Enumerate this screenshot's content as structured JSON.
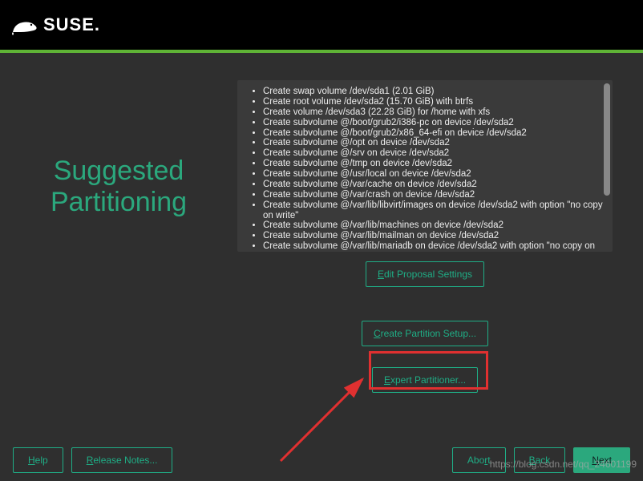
{
  "brand": {
    "name": "SUSE."
  },
  "page": {
    "title_line1": "Suggested",
    "title_line2": "Partitioning"
  },
  "partitions": [
    "Create swap volume /dev/sda1 (2.01 GiB)",
    "Create root volume /dev/sda2 (15.70 GiB) with btrfs",
    "Create volume /dev/sda3 (22.28 GiB) for /home with xfs",
    "Create subvolume @/boot/grub2/i386-pc on device /dev/sda2",
    "Create subvolume @/boot/grub2/x86_64-efi on device /dev/sda2",
    "Create subvolume @/opt on device /dev/sda2",
    "Create subvolume @/srv on device /dev/sda2",
    "Create subvolume @/tmp on device /dev/sda2",
    "Create subvolume @/usr/local on device /dev/sda2",
    "Create subvolume @/var/cache on device /dev/sda2",
    "Create subvolume @/var/crash on device /dev/sda2",
    "Create subvolume @/var/lib/libvirt/images on device /dev/sda2 with option \"no copy on write\"",
    "Create subvolume @/var/lib/machines on device /dev/sda2",
    "Create subvolume @/var/lib/mailman on device /dev/sda2",
    "Create subvolume @/var/lib/mariadb on device /dev/sda2 with option \"no copy on write\""
  ],
  "buttons": {
    "edit_proposal": "Edit Proposal Settings",
    "edit_proposal_ul": "E",
    "create_partition": "Create Partition Setup...",
    "create_partition_ul": "C",
    "expert_partitioner": "Expert Partitioner...",
    "expert_partitioner_ul": "E"
  },
  "footer": {
    "help": "Help",
    "help_ul": "H",
    "release": "Release Notes...",
    "release_ul": "R",
    "abort": "Abort",
    "abort_ul": "r",
    "back": "Back",
    "back_ul": "B",
    "next": "Next",
    "next_ul": "N"
  },
  "watermark": "https://blog.csdn.net/qq_24601199"
}
